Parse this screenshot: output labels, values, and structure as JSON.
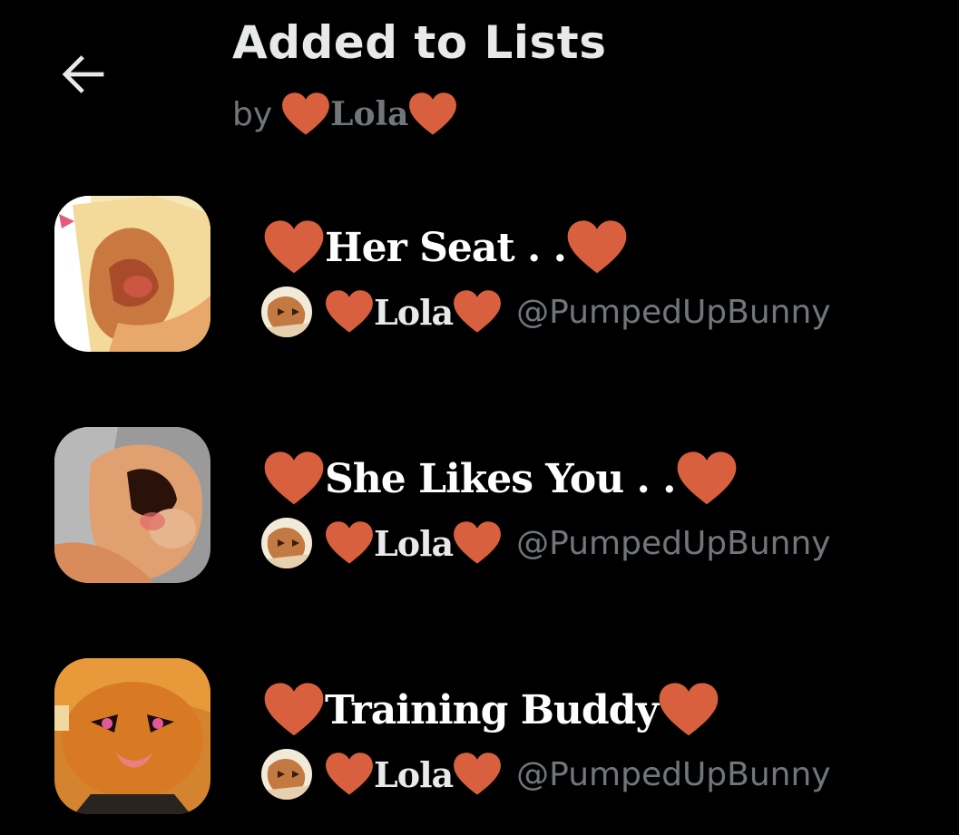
{
  "header": {
    "back_icon": "arrow-left-icon",
    "title": "Added to Lists",
    "by_label": "by",
    "owner_name": "Lola"
  },
  "colors": {
    "background": "#000000",
    "heart": "#d9603f",
    "primary_text": "#e7e9ea",
    "secondary_text": "#71767b"
  },
  "lists": [
    {
      "name": "Her Seat . .",
      "owner_name": "Lola",
      "handle": "@PumpedUpBunny"
    },
    {
      "name": "She Likes You . .",
      "owner_name": "Lola",
      "handle": "@PumpedUpBunny"
    },
    {
      "name": "Training Buddy",
      "owner_name": "Lola",
      "handle": "@PumpedUpBunny"
    }
  ]
}
